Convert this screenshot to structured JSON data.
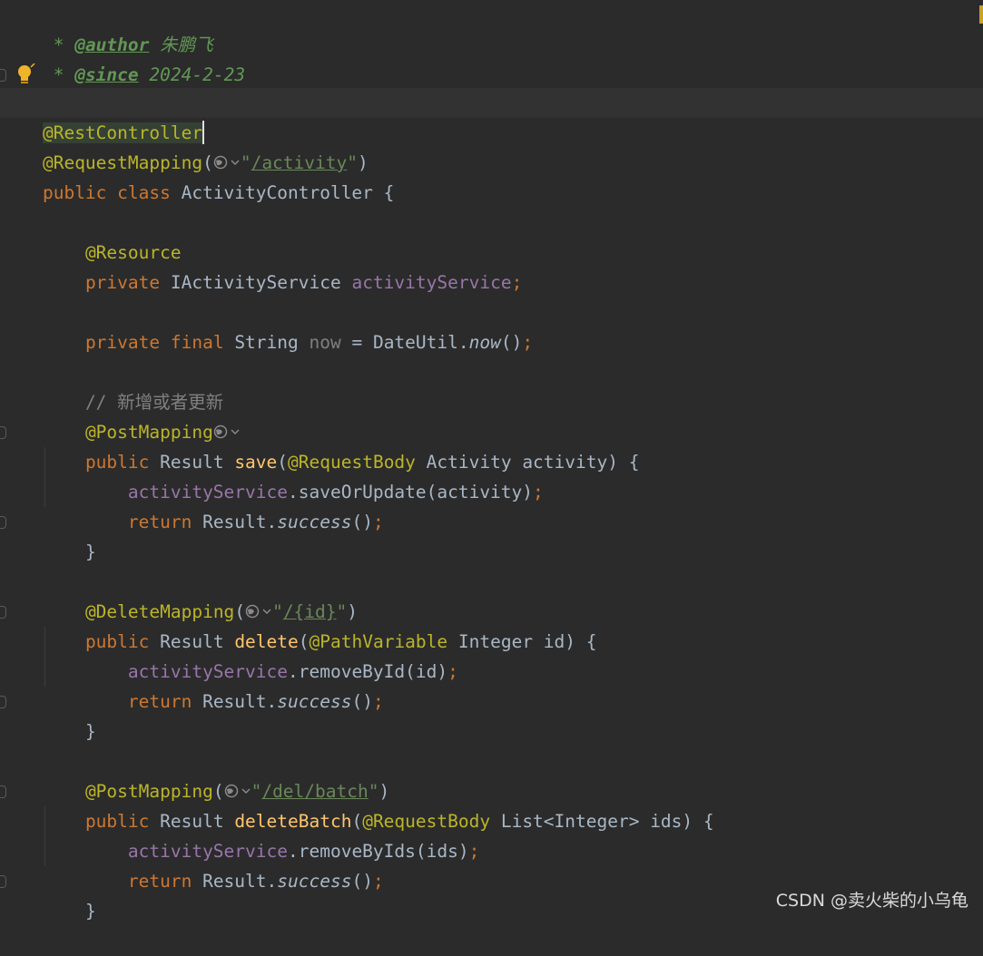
{
  "code": {
    "l1": {
      "star": " * ",
      "tag": "@author",
      "text": " 朱鹏飞"
    },
    "l2": {
      "star": " * ",
      "tag": "@since",
      "text": " 2024-2-23"
    },
    "l4": {
      "ann": "@RestController"
    },
    "l5": {
      "ann": "@RequestMapping",
      "open": "(",
      "q1": "\"",
      "path": "/activity",
      "q2": "\"",
      "close": ")"
    },
    "l6": {
      "kw": "public class ",
      "name": "ActivityController {"
    },
    "l8": {
      "ann": "@Resource"
    },
    "l9": {
      "kw": "private ",
      "type": "IActivityService ",
      "field": "activityService",
      "semi": ";"
    },
    "l11": {
      "kw": "private final ",
      "type": "String ",
      "var": "now",
      "eq": " = DateUtil.",
      "call": "now",
      "rest": "()",
      "semi": ";"
    },
    "l13": {
      "comment": "// 新增或者更新"
    },
    "l14": {
      "ann": "@PostMapping"
    },
    "l15": {
      "kw": "public ",
      "type": "Result ",
      "method": "save",
      "open": "(",
      "ann": "@RequestBody",
      "rest": " Activity activity) {"
    },
    "l16": {
      "field": "activityService",
      "rest": ".saveOrUpdate(activity)",
      "semi": ";"
    },
    "l17": {
      "kw": "return ",
      "type": "Result.",
      "call": "success",
      "rest": "()",
      "semi": ";"
    },
    "l18": {
      "brace": "}"
    },
    "l20": {
      "ann": "@DeleteMapping",
      "open": "(",
      "q1": "\"",
      "path": "/{id}",
      "q2": "\"",
      "close": ")"
    },
    "l21": {
      "kw": "public ",
      "type": "Result ",
      "method": "delete",
      "open": "(",
      "ann": "@PathVariable",
      "rest": " Integer id) {"
    },
    "l22": {
      "field": "activityService",
      "rest": ".removeById(id)",
      "semi": ";"
    },
    "l23": {
      "kw": "return ",
      "type": "Result.",
      "call": "success",
      "rest": "()",
      "semi": ";"
    },
    "l24": {
      "brace": "}"
    },
    "l26": {
      "ann": "@PostMapping",
      "open": "(",
      "q1": "\"",
      "path": "/del/batch",
      "q2": "\"",
      "close": ")"
    },
    "l27": {
      "kw": "public ",
      "type": "Result ",
      "method": "deleteBatch",
      "open": "(",
      "ann": "@RequestBody",
      "rest": " List<Integer> ids) {"
    },
    "l28": {
      "field": "activityService",
      "rest": ".removeByIds(ids)",
      "semi": ";"
    },
    "l29": {
      "kw": "return ",
      "type": "Result.",
      "call": "success",
      "rest": "()",
      "semi": ";"
    },
    "l30": {
      "brace": "}"
    }
  },
  "watermark": "CSDN @卖火柴的小乌龟",
  "icons": [
    "globe-icon",
    "chevron-down-icon",
    "lightbulb-icon"
  ],
  "colors": {
    "background": "#2b2b2b",
    "keyword": "#cc7832",
    "annotation": "#bbb529",
    "string": "#6a8759",
    "field": "#9876aa",
    "method": "#ffc66d",
    "text": "#a9b7c6",
    "comment": "#808080"
  }
}
